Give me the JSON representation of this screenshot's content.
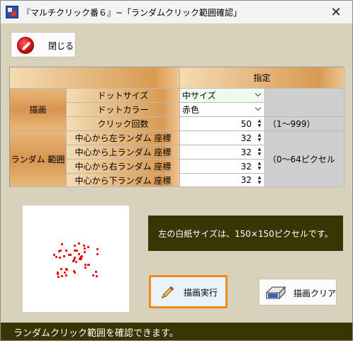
{
  "window": {
    "title": "『マルチクリック番６』−「ランダムクリック範囲確認」",
    "close_glyph": "✕"
  },
  "toolbar": {
    "close_label": "閉じる",
    "close_icon": "no-entry-icon"
  },
  "grid": {
    "header_label": "指定",
    "group_draw": "描画",
    "group_range": "ランダム 範囲",
    "rows": [
      {
        "label": "ドットサイズ",
        "value": "中サイズ",
        "kind": "dropdown"
      },
      {
        "label": "ドットカラー",
        "value": "赤色",
        "kind": "dropdown"
      },
      {
        "label": "クリック回数",
        "value": "50",
        "kind": "spin",
        "note": "（1～999）"
      },
      {
        "label": "中心から左ランダム 座標",
        "value": "32",
        "kind": "spin"
      },
      {
        "label": "中心から上ランダム 座標",
        "value": "32",
        "kind": "spin"
      },
      {
        "label": "中心から右ランダム 座標",
        "value": "32",
        "kind": "spin"
      },
      {
        "label": "中心から下ランダム 座標",
        "value": "32",
        "kind": "spin"
      }
    ],
    "range_note": "（0～64ピクセル"
  },
  "info_text": "左の白紙サイズは、150×150ピクセルです。",
  "buttons": {
    "draw_label": "描画実行",
    "draw_icon": "pencil-icon",
    "clear_label": "描画クリア",
    "clear_icon": "eraser-icon"
  },
  "status_text": "ランダムクリック範囲を確認できます。",
  "colors": {
    "accent_orange": "#f08a1a",
    "dot_red": "#ee0000",
    "dark_olive": "#3a3505"
  }
}
